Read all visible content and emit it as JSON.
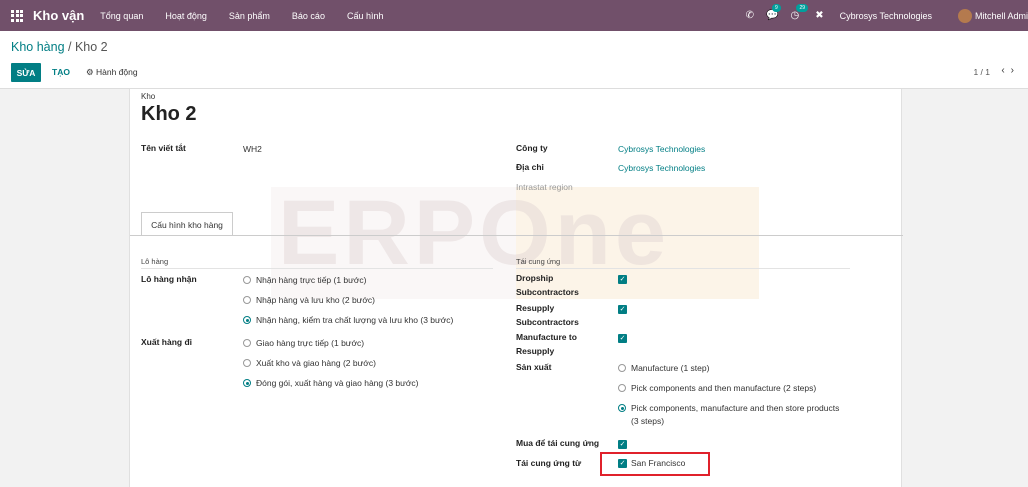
{
  "navbar": {
    "app_name": "Kho vận",
    "menu": [
      "Tổng quan",
      "Hoạt động",
      "Sản phẩm",
      "Báo cáo",
      "Cấu hình"
    ],
    "chat_badge": "9",
    "activity_badge": "29",
    "company": "Cybrosys Technologies",
    "user": "Mitchell Admi"
  },
  "breadcrumb": {
    "parent": "Kho hàng",
    "separator": " / ",
    "current": "Kho 2"
  },
  "toolbar": {
    "edit_label": "SỬA",
    "create_label": "TẠO",
    "action_label": "⚙ Hành động"
  },
  "pager": {
    "value": "1 / 1"
  },
  "form": {
    "name_label": "Kho",
    "name": "Kho 2",
    "short_name_label": "Tên viết tắt",
    "short_name": "WH2",
    "company_label": "Công ty",
    "company": "Cybrosys Technologies",
    "address_label": "Địa chỉ",
    "address": "Cybrosys Technologies",
    "intrastat_label": "Intrastat region",
    "tab_label": "Cấu hình kho hàng",
    "shipments_group": "Lô hàng",
    "incoming_label": "Lô hàng nhận",
    "incoming_options": [
      "Nhận hàng trực tiếp (1 bước)",
      "Nhập hàng và lưu kho (2 bước)",
      "Nhận hàng, kiểm tra chất lượng và lưu kho (3 bước)"
    ],
    "incoming_selected": 2,
    "outgoing_label": "Xuất hàng đi",
    "outgoing_options": [
      "Giao hàng trực tiếp (1 bước)",
      "Xuất kho và giao hàng (2 bước)",
      "Đóng gói, xuất hàng và giao hàng (3 bước)"
    ],
    "outgoing_selected": 2,
    "resupply_group": "Tái cung ứng",
    "dropship_label_1": "Dropship",
    "dropship_label_2": "Subcontractors",
    "resupply_sub_label_1": "Resupply",
    "resupply_sub_label_2": "Subcontractors",
    "manufacture_resupply_label_1": "Manufacture to",
    "manufacture_resupply_label_2": "Resupply",
    "manufacture_label": "Sản xuất",
    "manufacture_options": [
      "Manufacture (1 step)",
      "Pick components and then manufacture (2 steps)",
      "Pick components, manufacture and then store products"
    ],
    "manufacture_option_3_cont": "(3 steps)",
    "manufacture_selected": 2,
    "buy_resupply_label": "Mua để tái cung ứng",
    "resupply_from_label": "Tái cung ứng từ",
    "resupply_from_value": "San Francisco"
  },
  "watermark": {
    "text": "ERPOne"
  }
}
